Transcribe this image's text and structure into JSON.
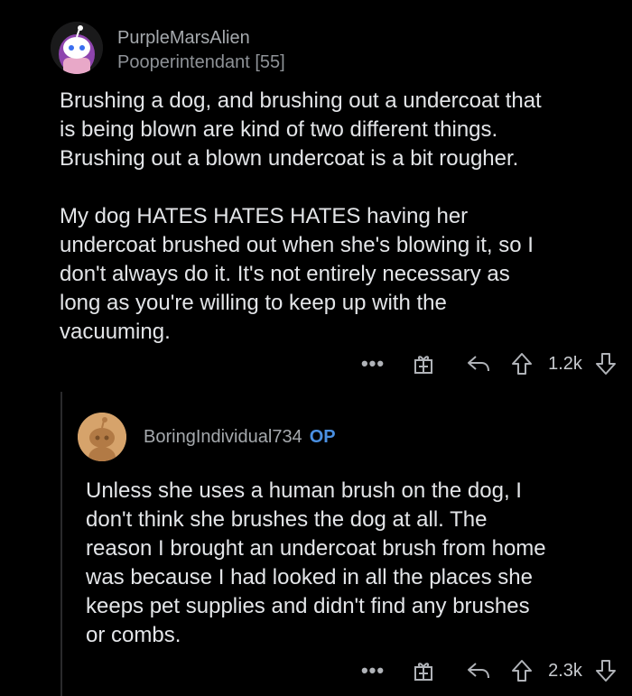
{
  "comments": [
    {
      "username": "PurpleMarsAlien",
      "flair": "Pooperintendant [55]",
      "paragraphs": [
        [
          "Brushing a dog, and brushing out a undercoat that",
          "is being blown are kind of two different things.",
          "Brushing out a blown undercoat is a bit rougher."
        ],
        [
          "My dog HATES HATES HATES having her",
          "undercoat brushed out when she's blowing it, so I",
          "don't always do it. It's not entirely necessary as",
          "long as you're willing to keep up with the",
          "vacuuming."
        ]
      ],
      "actions": {
        "more": "•••",
        "score": "1.2k"
      }
    },
    {
      "username": "BoringIndividual734",
      "badge": "OP",
      "paragraphs": [
        [
          "Unless she uses a human brush on the dog, I",
          "don't think she brushes the dog at all. The",
          "reason I brought an undercoat brush from home",
          "was because I had looked in all the places she",
          "keeps pet supplies and didn't find any brushes",
          "or combs."
        ]
      ],
      "actions": {
        "more": "•••",
        "score": "2.3k"
      }
    }
  ],
  "icons": {
    "more": "more-options-icon",
    "award": "gift-award-icon",
    "reply": "reply-icon",
    "upvote": "upvote-arrow-icon",
    "downvote": "downvote-arrow-icon"
  },
  "colors": {
    "background": "#000000",
    "op_badge": "#4a90e2",
    "avatar1_hair": "#8e44ad",
    "avatar2_bg": "#d6a36b"
  }
}
